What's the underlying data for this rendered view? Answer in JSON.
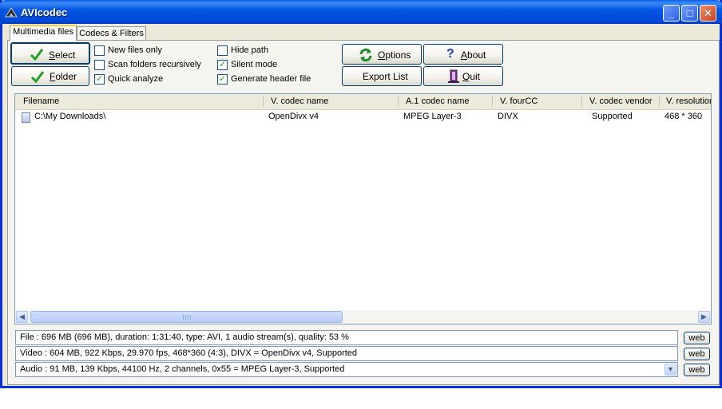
{
  "window": {
    "title": "AVIcodec"
  },
  "tabs": [
    {
      "label": "Multimedia files",
      "active": true
    },
    {
      "label": "Codecs & Filters",
      "active": false
    }
  ],
  "buttons": {
    "select": {
      "label_first": "S",
      "label_rest": "elect"
    },
    "folder": {
      "label_first": "F",
      "label_rest": "older"
    },
    "options": {
      "label_first": "O",
      "label_rest": "ptions"
    },
    "export": {
      "label": "Export List"
    },
    "about": {
      "label_first": "A",
      "label_rest": "bout"
    },
    "quit": {
      "label_first": "Q",
      "label_rest": "uit"
    }
  },
  "checkboxes": [
    {
      "label": "New files only",
      "checked": false
    },
    {
      "label": "Scan folders recursively",
      "checked": false
    },
    {
      "label": "Quick analyze",
      "checked": true
    },
    {
      "label": "Hide path",
      "checked": false
    },
    {
      "label": "Silent mode",
      "checked": true
    },
    {
      "label": "Generate header file",
      "checked": true
    }
  ],
  "table": {
    "columns": [
      "Filename",
      "V. codec name",
      "A.1 codec name",
      "V. fourCC",
      "V. codec vendor",
      "V. resolution"
    ],
    "rows": [
      {
        "filename": "C:\\My Downloads\\",
        "v_codec": "OpenDivx v4",
        "a_codec": "MPEG Layer-3",
        "fourcc": "DIVX",
        "vendor": "Supported",
        "resolution": "468 * 360"
      }
    ]
  },
  "info": {
    "file": "File    :  696 MB (696 MB),  duration: 1:31:40,  type: AVI,  1 audio stream(s),  quality: 53 %",
    "video": "Video :  604 MB,  922 Kbps,  29.970 fps,  468*360 (4:3),  DIVX = OpenDivx v4,    Supported",
    "audio": "Audio :  91 MB,  139 Kbps,  44100 Hz,  2 channels,  0x55 = MPEG Layer-3,    Supported",
    "web_label": "web"
  },
  "colors": {
    "accent": "#0a5fe8",
    "check": "#21a121"
  },
  "icons": [
    "app-icon",
    "check-icon",
    "refresh-icon",
    "question-icon",
    "quit-icon",
    "file-icon"
  ]
}
